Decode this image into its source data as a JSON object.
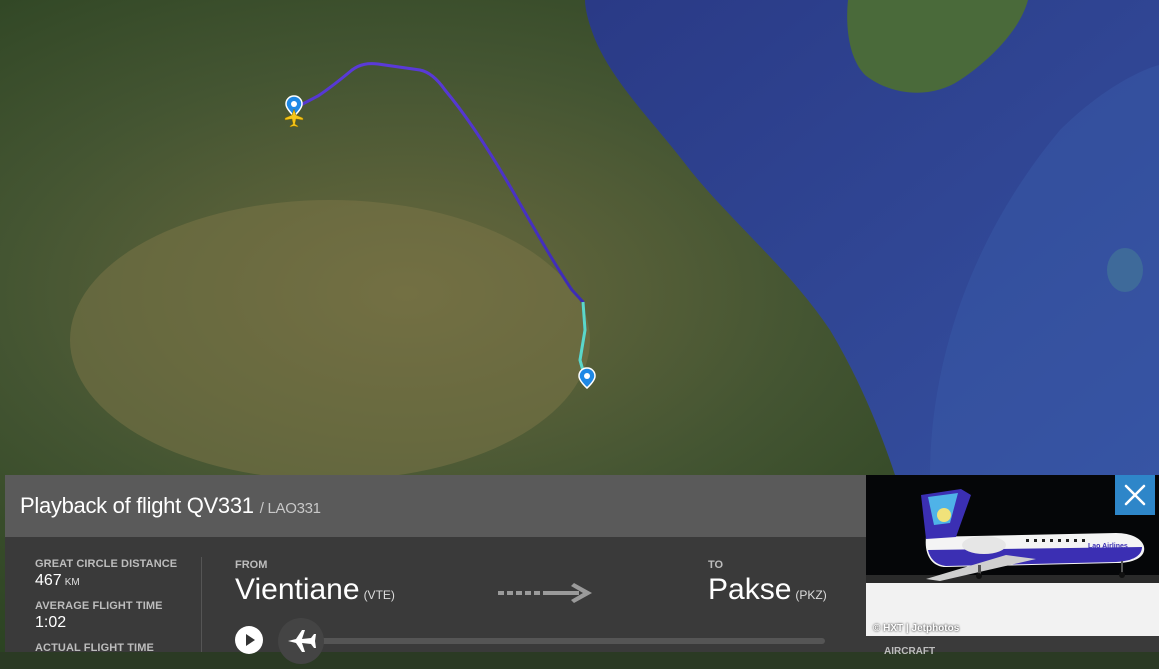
{
  "panel": {
    "title": "Playback of flight QV331",
    "callsign": "/ LAO331",
    "stats": [
      {
        "label": "GREAT CIRCLE DISTANCE",
        "value": "467",
        "unit": "KM"
      },
      {
        "label": "AVERAGE FLIGHT TIME",
        "value": "1:02",
        "unit": ""
      },
      {
        "label": "ACTUAL FLIGHT TIME",
        "value": "",
        "unit": ""
      }
    ],
    "from": {
      "label": "FROM",
      "city": "Vientiane",
      "code": "(VTE)"
    },
    "to": {
      "label": "TO",
      "city": "Pakse",
      "code": "(PKZ)"
    },
    "playback_progress": 0.0
  },
  "photo": {
    "credit": "© HXT | Jetphotos",
    "airline_text": "Lao Airlines",
    "next_label": "AIRCRAFT"
  },
  "icons": {
    "close": "close-icon",
    "play": "play-icon",
    "plane": "plane-icon",
    "pin": "map-pin-icon",
    "arrow": "arrow-right-icon"
  },
  "colors": {
    "accent": "#2e86c9",
    "track_start": "#29b6f6",
    "track_mid": "#4b2bd1",
    "track_end": "#c6ff00"
  }
}
